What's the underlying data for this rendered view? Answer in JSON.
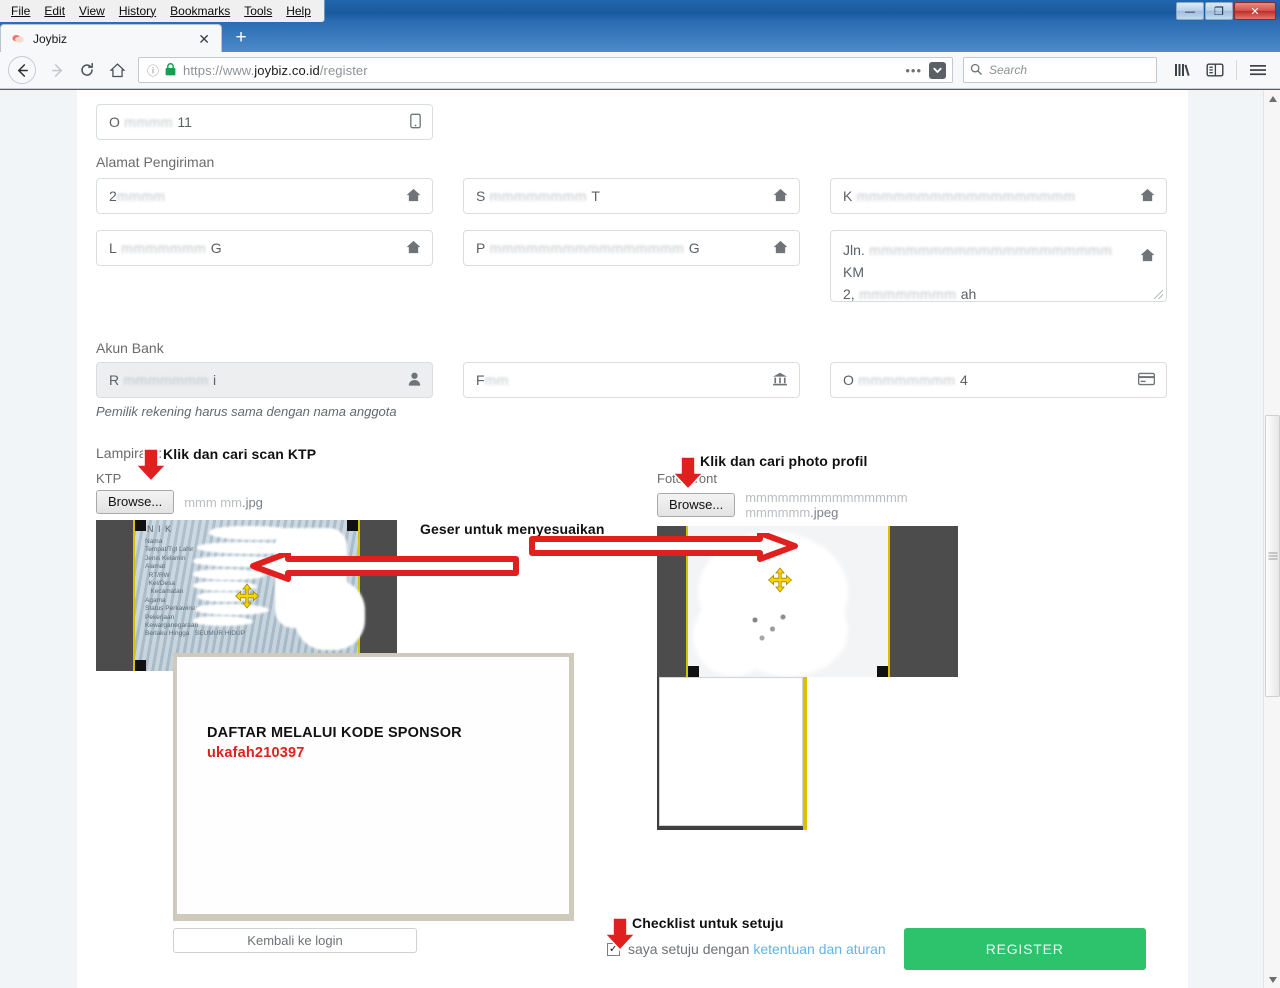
{
  "browser": {
    "menu": [
      "File",
      "Edit",
      "View",
      "History",
      "Bookmarks",
      "Tools",
      "Help"
    ],
    "window_controls": {
      "minimize": "—",
      "maximize": "❐",
      "close": "✕"
    },
    "tab": {
      "title": "Joybiz",
      "close": "✕",
      "newtab": "+"
    },
    "url": {
      "scheme": "https://www.",
      "host": "joybiz.co.id",
      "path": "/register"
    },
    "search_placeholder": "Search",
    "nav": {
      "back": "←",
      "forward": "→",
      "reload": "⟳",
      "home": "⌂",
      "dots": "•••"
    }
  },
  "form": {
    "phone_value_prefix": "O",
    "phone_value_suffix": "11",
    "shipping_heading": "Alamat Pengiriman",
    "shipping": [
      {
        "prefix": "2",
        "suffix": ""
      },
      {
        "prefix": "S",
        "suffix": "T"
      },
      {
        "prefix": "K",
        "suffix": ""
      },
      {
        "prefix": "L",
        "suffix": "G"
      },
      {
        "prefix": "P",
        "suffix": "G"
      }
    ],
    "address_line1_prefix": "Jln.",
    "address_line1_suffix": "KM",
    "address_line2_prefix": "2,",
    "address_line2_suffix": "ah",
    "bank_heading": "Akun Bank",
    "bank_account_name_prefix": "R",
    "bank_account_name_suffix": "i",
    "bank_name_prefix": "F",
    "bank_number_prefix": "O",
    "bank_number_suffix": "4",
    "bank_hint": "Pemilik rekening harus sama dengan nama anggota"
  },
  "attachments": {
    "heading": "Lampiran :",
    "ktp_label": "KTP",
    "ktp_browse": "Browse...",
    "ktp_filename_suffix": ".jpg",
    "photo_label": "Foto Front",
    "photo_browse": "Browse...",
    "photo_filename_suffix": ".jpeg"
  },
  "annotations": {
    "ktp": "Klik dan cari scan KTP",
    "photo": "Klik dan cari photo profil",
    "drag": "Geser untuk menyesuaikan",
    "checklist": "Checklist untuk setuju"
  },
  "sponsor_card": {
    "title": "DAFTAR MELALUI KODE SPONSOR",
    "code": "ukafah210397"
  },
  "ktp_card": {
    "nik_label": "N I K",
    "fields": [
      "Nama",
      "Tempat/Tgl Lahir",
      "Jenis Kelamin",
      "Alamat",
      "RT/RW",
      "Kel/Desa",
      "Kecamatan",
      "Agama",
      "Status Perkawinan",
      "Pekerjaan",
      "Kewarganegaraan",
      "Berlaku Hingga"
    ],
    "berlaku_value": "SEUMUR HIDUP"
  },
  "footer": {
    "back_to_login": "Kembali ke login",
    "agree_prefix": "saya setuju dengan",
    "agree_link": "ketentuan dan aturan",
    "register": "REGISTER",
    "checkbox_checked": "✓"
  },
  "colors": {
    "register_green": "#2dc36d",
    "link_blue": "#63b3e8",
    "annotation_red": "#e01f1f",
    "sponsor_code_red": "#e02020",
    "crop_yellow": "#d8c200"
  }
}
